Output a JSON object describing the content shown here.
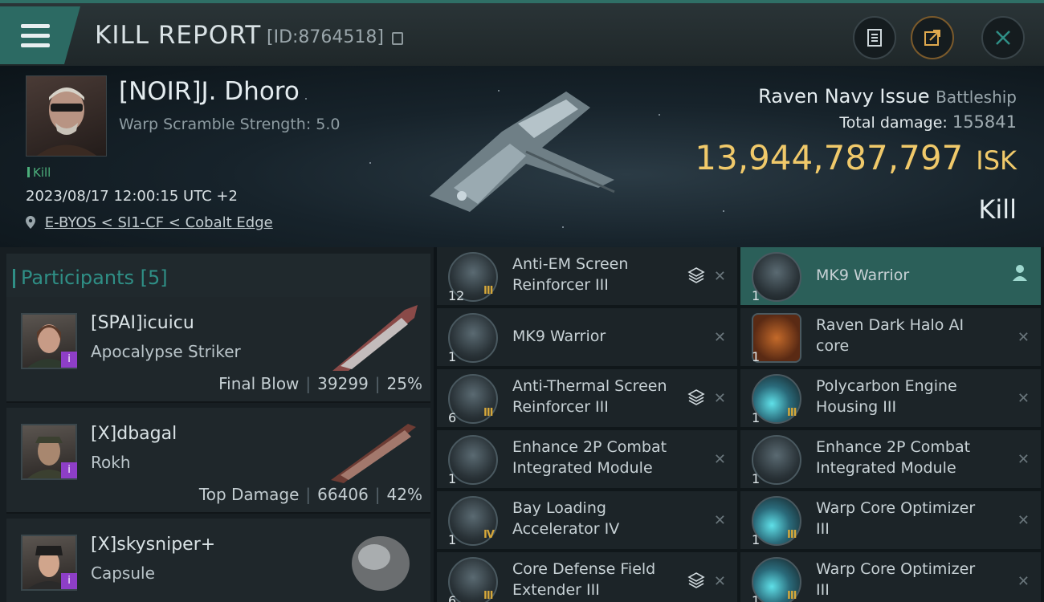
{
  "header": {
    "title": "KILL REPORT",
    "id_label": "[ID:8764518]"
  },
  "victim": {
    "name": "[NOIR]J. Dhoro",
    "warp_scramble": "Warp Scramble Strength: 5.0",
    "tag": "Kill",
    "datetime": "2023/08/17 12:00:15 UTC +2",
    "location": "E-BYOS < SI1-CF < Cobalt Edge",
    "ship": "Raven Navy Issue",
    "ship_class": "Battleship",
    "total_damage_label": "Total damage:",
    "total_damage": "155841",
    "isk_value": "13,944,787,797",
    "isk_unit": "ISK",
    "result": "Kill"
  },
  "participants": {
    "title": "Participants",
    "count": "[5]",
    "rows": [
      {
        "name": "[SPAI]icuicu",
        "ship": "Apocalypse Striker",
        "role": "Final Blow",
        "damage": "39299",
        "pct": "25%"
      },
      {
        "name": "[X]dbagal",
        "ship": "Rokh",
        "role": "Top Damage",
        "damage": "66406",
        "pct": "42%"
      },
      {
        "name": "[X]skysniper+",
        "ship": "Capsule"
      }
    ]
  },
  "items": {
    "left": [
      {
        "qty": "12",
        "tier": "III",
        "name": "Anti-EM Screen Reinforcer III",
        "stack": true
      },
      {
        "qty": "1",
        "tier": "",
        "name": "MK9  Warrior",
        "stack": false
      },
      {
        "qty": "6",
        "tier": "III",
        "name": "Anti-Thermal Screen Reinforcer III",
        "stack": true
      },
      {
        "qty": "1",
        "tier": "",
        "name": "Enhance 2P Combat Integrated Module",
        "stack": false
      },
      {
        "qty": "1",
        "tier": "IV",
        "name": "Bay Loading Accelerator IV",
        "stack": false
      },
      {
        "qty": "6",
        "tier": "III",
        "name": "Core Defense Field Extender III",
        "stack": true
      }
    ],
    "right": [
      {
        "qty": "1",
        "tier": "",
        "name": "MK9  Warrior",
        "highlight": true
      },
      {
        "qty": "1",
        "tier": "",
        "name": "Raven Dark Halo AI core"
      },
      {
        "qty": "1",
        "tier": "III",
        "name": "Polycarbon Engine Housing III"
      },
      {
        "qty": "1",
        "tier": "",
        "name": "Enhance 2P Combat Integrated Module"
      },
      {
        "qty": "1",
        "tier": "III",
        "name": "Warp Core Optimizer III"
      },
      {
        "qty": "1",
        "tier": "III",
        "name": "Warp Core Optimizer III"
      }
    ],
    "remove_glyph": "✕"
  },
  "colors": {
    "accent": "#2f8f86",
    "isk": "#f0c96a",
    "kill": "#4caf7b",
    "corp_badge": "#8e3ec7"
  }
}
